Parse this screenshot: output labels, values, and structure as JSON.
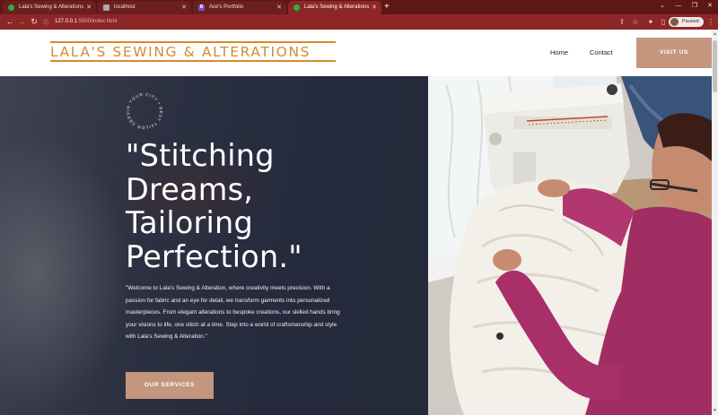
{
  "browser": {
    "tabs": [
      {
        "title": "Lala's Sewing & Alterations",
        "icon": "green-check-favicon",
        "active": false
      },
      {
        "title": "localhost",
        "icon": "page-favicon",
        "active": false
      },
      {
        "title": "Ace's Portfolio",
        "icon": "bootstrap-favicon",
        "active": false
      },
      {
        "title": "Lala's Sewing & Alterations",
        "icon": "green-check-favicon",
        "active": true
      }
    ],
    "url_host": "127.0.0.1",
    "url_rest": ":5500/index.html",
    "profile_label": "Paused",
    "colors": {
      "tab_strip": "#5e1717",
      "toolbar": "#8d2626"
    }
  },
  "site": {
    "logo_text": "Lala's Sewing & Alterations",
    "nav": {
      "home": "Home",
      "contact": "Contact"
    },
    "visit_button": "VISIT US",
    "accent_color": "#c4967d",
    "logo_color": "#d78a2d"
  },
  "hero": {
    "badge_text": "IN YOUR CITY • BEST TAILOR SERVICE •",
    "title_lines": [
      "\"Stitching",
      "Dreams,",
      "Tailoring",
      "Perfection.\""
    ],
    "intro": "\"Welcome to Lala's Sewing & Alteration, where creativity meets precision. With a passion for fabric and an eye for detail, we transform garments into personalized masterpieces. From elegant alterations to bespoke creations, our skilled hands bring your visions to life, one stitch at a time. Step into a world of craftsmanship and style with Lala's Sewing & Alteration.\"",
    "cta": "OUR SERVICES"
  }
}
